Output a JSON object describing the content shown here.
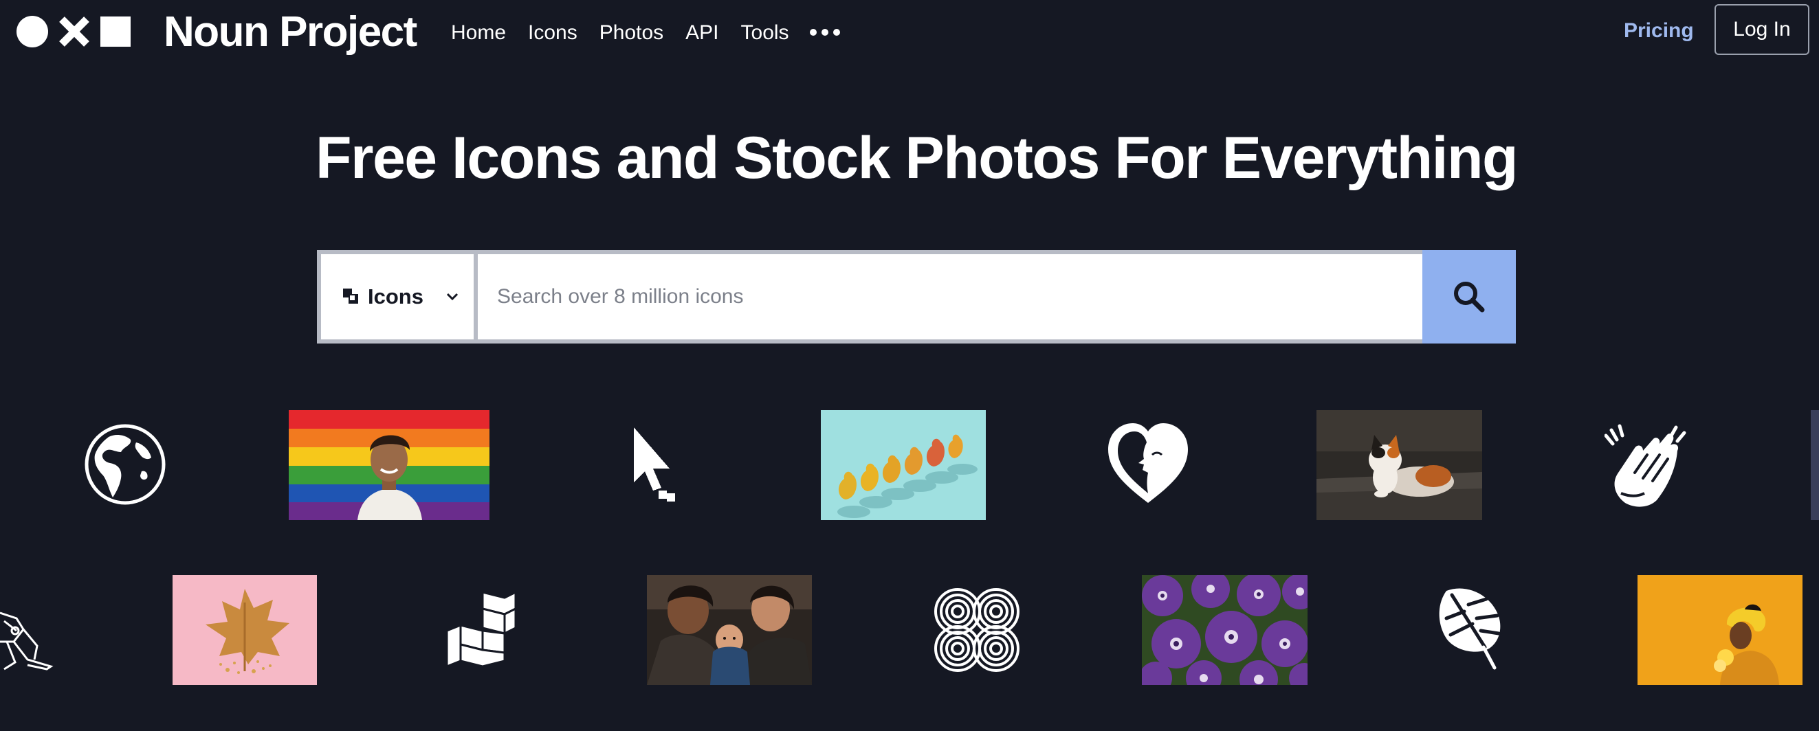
{
  "header": {
    "brand": "Noun Project",
    "nav": [
      "Home",
      "Icons",
      "Photos",
      "API",
      "Tools"
    ],
    "more_icon": "ellipsis-icon",
    "pricing": "Pricing",
    "login": "Log In"
  },
  "hero": {
    "headline": "Free Icons and Stock Photos For Everything"
  },
  "search": {
    "type_label": "Icons",
    "placeholder": "Search over 8 million icons",
    "value": "",
    "button_icon": "magnifier-icon"
  },
  "gallery": {
    "row1": [
      "globe-icon",
      "pride-flag-portrait-photo",
      "pointer-cursor-icon",
      "pears-photo",
      "heart-face-icon",
      "calico-cat-photo",
      "clapping-hands-icon"
    ],
    "row2": [
      "robot-dog-icon",
      "golden-leaf-photo",
      "blocks-icon",
      "family-baby-photo",
      "concentric-loops-icon",
      "purple-petunias-photo",
      "monstera-leaf-icon",
      "yellow-portrait-photo"
    ]
  },
  "colors": {
    "background": "#151823",
    "accent": "#8fb0ef",
    "pricing": "#9fb9ee"
  }
}
